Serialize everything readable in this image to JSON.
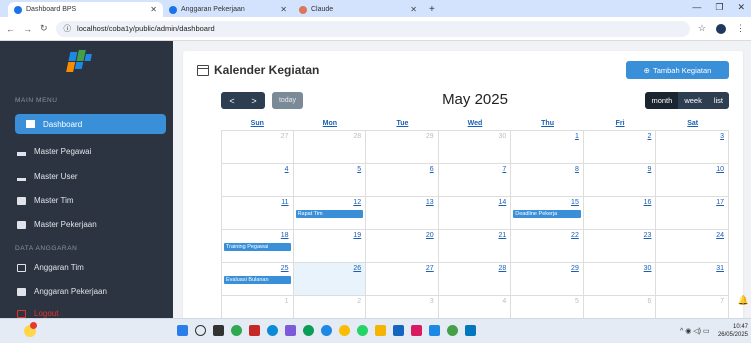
{
  "browser": {
    "tabs": [
      {
        "label": "Dashboard BPS",
        "active": true
      },
      {
        "label": "Anggaran Pekerjaan",
        "active": false
      },
      {
        "label": "Claude",
        "active": false
      }
    ],
    "url": "localhost/coba1y/public/admin/dashboard"
  },
  "sidebar": {
    "heading_main": "MAIN MENU",
    "heading_data": "DATA ANGGARAN",
    "items": [
      {
        "label": "Dashboard",
        "icon": "dashboard-icon",
        "active": true
      },
      {
        "label": "Master Pegawai",
        "icon": "users-icon"
      },
      {
        "label": "Master User",
        "icon": "sitemap-icon"
      },
      {
        "label": "Master Tim",
        "icon": "team-icon"
      },
      {
        "label": "Master Pekerjaan",
        "icon": "briefcase-icon"
      },
      {
        "label": "Anggaran Tim",
        "icon": "money-icon"
      },
      {
        "label": "Anggaran Pekerjaan",
        "icon": "list-icon"
      },
      {
        "label": "Logout",
        "icon": "logout-icon"
      }
    ]
  },
  "card": {
    "title": "Kalender Kegiatan",
    "add_button": "Tambah Kegiatan"
  },
  "calendar": {
    "prev": "<",
    "next": ">",
    "today": "today",
    "title": "May 2025",
    "views": [
      "month",
      "week",
      "list"
    ],
    "active_view": "month",
    "days_of_week": [
      "Sun",
      "Mon",
      "Tue",
      "Wed",
      "Thu",
      "Fri",
      "Sat"
    ],
    "weeks": [
      [
        "27",
        "28",
        "29",
        "30",
        "1",
        "2",
        "3"
      ],
      [
        "4",
        "5",
        "6",
        "7",
        "8",
        "9",
        "10"
      ],
      [
        "11",
        "12",
        "13",
        "14",
        "15",
        "16",
        "17"
      ],
      [
        "18",
        "19",
        "20",
        "21",
        "22",
        "23",
        "24"
      ],
      [
        "25",
        "26",
        "27",
        "28",
        "29",
        "30",
        "31"
      ],
      [
        "1",
        "2",
        "3",
        "4",
        "5",
        "6",
        "7"
      ]
    ],
    "events": {
      "rapat": "Rapat Tim",
      "deadline": "Deadline Pekerja",
      "training": "Training Pegawai",
      "evaluasi": "Evaluasi Bulanan"
    }
  },
  "taskbar": {
    "time": "10:47",
    "date": "26/05/2025"
  },
  "colors": {
    "sidebar_bg": "#2c3441",
    "accent": "#3a8fd9",
    "nav_dark": "#2c3e50"
  }
}
